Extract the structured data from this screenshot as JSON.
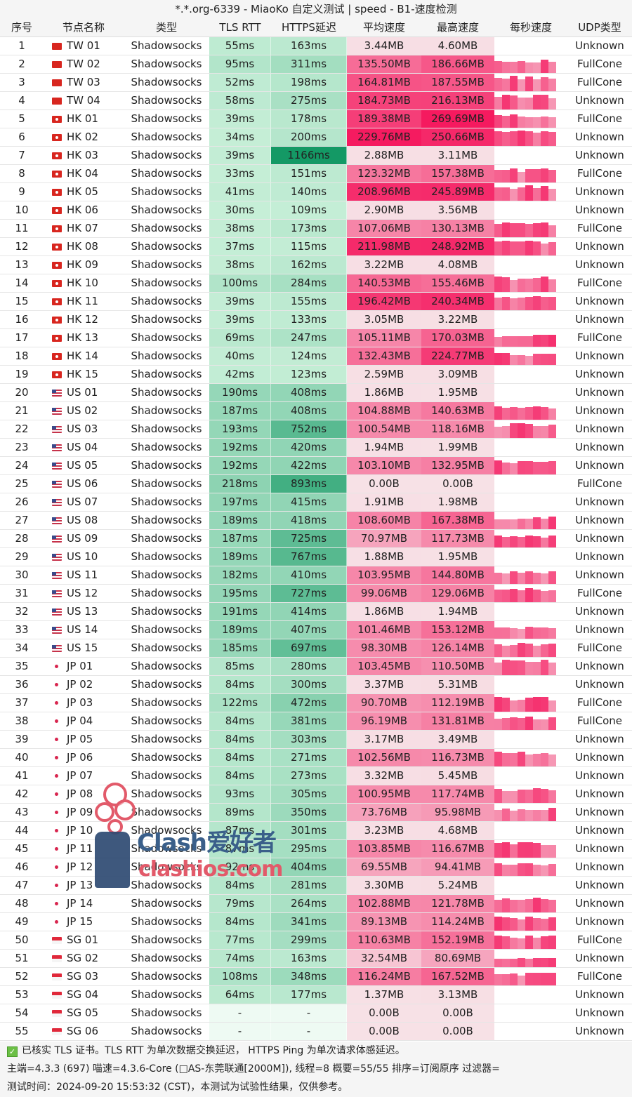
{
  "window": {
    "title": "*.*.org-6339 - MiaoKo 自定义测试 | speed - B1-速度检测"
  },
  "table": {
    "headers": [
      "序号",
      "节点名称",
      "类型",
      "TLS RTT",
      "HTTPS延迟",
      "平均速度",
      "最高速度",
      "每秒速度",
      "UDP类型"
    ],
    "rows": [
      {
        "idx": "1",
        "flag": "tw",
        "name": "TW 01",
        "type": "Shadowsocks",
        "tls": "55ms",
        "https": "163ms",
        "avg": "3.44MB",
        "max": "4.60MB",
        "udp": "Unknown"
      },
      {
        "idx": "2",
        "flag": "tw",
        "name": "TW 02",
        "type": "Shadowsocks",
        "tls": "95ms",
        "https": "311ms",
        "avg": "135.50MB",
        "max": "186.66MB",
        "udp": "FullCone"
      },
      {
        "idx": "3",
        "flag": "tw",
        "name": "TW 03",
        "type": "Shadowsocks",
        "tls": "52ms",
        "https": "198ms",
        "avg": "164.81MB",
        "max": "187.55MB",
        "udp": "FullCone"
      },
      {
        "idx": "4",
        "flag": "tw",
        "name": "TW 04",
        "type": "Shadowsocks",
        "tls": "58ms",
        "https": "275ms",
        "avg": "184.73MB",
        "max": "216.13MB",
        "udp": "Unknown"
      },
      {
        "idx": "5",
        "flag": "hk",
        "name": "HK 01",
        "type": "Shadowsocks",
        "tls": "39ms",
        "https": "178ms",
        "avg": "189.38MB",
        "max": "269.69MB",
        "udp": "FullCone"
      },
      {
        "idx": "6",
        "flag": "hk",
        "name": "HK 02",
        "type": "Shadowsocks",
        "tls": "34ms",
        "https": "200ms",
        "avg": "229.76MB",
        "max": "250.66MB",
        "udp": "Unknown"
      },
      {
        "idx": "7",
        "flag": "hk",
        "name": "HK 03",
        "type": "Shadowsocks",
        "tls": "39ms",
        "https": "1166ms",
        "avg": "2.88MB",
        "max": "3.11MB",
        "udp": "Unknown"
      },
      {
        "idx": "8",
        "flag": "hk",
        "name": "HK 04",
        "type": "Shadowsocks",
        "tls": "33ms",
        "https": "151ms",
        "avg": "123.32MB",
        "max": "157.38MB",
        "udp": "FullCone"
      },
      {
        "idx": "9",
        "flag": "hk",
        "name": "HK 05",
        "type": "Shadowsocks",
        "tls": "41ms",
        "https": "140ms",
        "avg": "208.96MB",
        "max": "245.89MB",
        "udp": "Unknown"
      },
      {
        "idx": "10",
        "flag": "hk",
        "name": "HK 06",
        "type": "Shadowsocks",
        "tls": "30ms",
        "https": "109ms",
        "avg": "2.90MB",
        "max": "3.56MB",
        "udp": "Unknown"
      },
      {
        "idx": "11",
        "flag": "hk",
        "name": "HK 07",
        "type": "Shadowsocks",
        "tls": "38ms",
        "https": "173ms",
        "avg": "107.06MB",
        "max": "130.13MB",
        "udp": "FullCone"
      },
      {
        "idx": "12",
        "flag": "hk",
        "name": "HK 08",
        "type": "Shadowsocks",
        "tls": "37ms",
        "https": "115ms",
        "avg": "211.98MB",
        "max": "248.92MB",
        "udp": "Unknown"
      },
      {
        "idx": "13",
        "flag": "hk",
        "name": "HK 09",
        "type": "Shadowsocks",
        "tls": "38ms",
        "https": "162ms",
        "avg": "3.22MB",
        "max": "4.08MB",
        "udp": "Unknown"
      },
      {
        "idx": "14",
        "flag": "hk",
        "name": "HK 10",
        "type": "Shadowsocks",
        "tls": "100ms",
        "https": "284ms",
        "avg": "140.53MB",
        "max": "155.46MB",
        "udp": "FullCone"
      },
      {
        "idx": "15",
        "flag": "hk",
        "name": "HK 11",
        "type": "Shadowsocks",
        "tls": "39ms",
        "https": "155ms",
        "avg": "196.42MB",
        "max": "240.34MB",
        "udp": "Unknown"
      },
      {
        "idx": "16",
        "flag": "hk",
        "name": "HK 12",
        "type": "Shadowsocks",
        "tls": "39ms",
        "https": "133ms",
        "avg": "3.05MB",
        "max": "3.22MB",
        "udp": "Unknown"
      },
      {
        "idx": "17",
        "flag": "hk",
        "name": "HK 13",
        "type": "Shadowsocks",
        "tls": "69ms",
        "https": "247ms",
        "avg": "105.11MB",
        "max": "170.03MB",
        "udp": "FullCone"
      },
      {
        "idx": "18",
        "flag": "hk",
        "name": "HK 14",
        "type": "Shadowsocks",
        "tls": "40ms",
        "https": "124ms",
        "avg": "132.43MB",
        "max": "224.77MB",
        "udp": "Unknown"
      },
      {
        "idx": "19",
        "flag": "hk",
        "name": "HK 15",
        "type": "Shadowsocks",
        "tls": "42ms",
        "https": "123ms",
        "avg": "2.59MB",
        "max": "3.09MB",
        "udp": "Unknown"
      },
      {
        "idx": "20",
        "flag": "us",
        "name": "US 01",
        "type": "Shadowsocks",
        "tls": "190ms",
        "https": "408ms",
        "avg": "1.86MB",
        "max": "1.95MB",
        "udp": "Unknown"
      },
      {
        "idx": "21",
        "flag": "us",
        "name": "US 02",
        "type": "Shadowsocks",
        "tls": "187ms",
        "https": "408ms",
        "avg": "104.88MB",
        "max": "140.63MB",
        "udp": "Unknown"
      },
      {
        "idx": "22",
        "flag": "us",
        "name": "US 03",
        "type": "Shadowsocks",
        "tls": "193ms",
        "https": "752ms",
        "avg": "100.54MB",
        "max": "118.16MB",
        "udp": "Unknown"
      },
      {
        "idx": "23",
        "flag": "us",
        "name": "US 04",
        "type": "Shadowsocks",
        "tls": "192ms",
        "https": "420ms",
        "avg": "1.94MB",
        "max": "1.99MB",
        "udp": "Unknown"
      },
      {
        "idx": "24",
        "flag": "us",
        "name": "US 05",
        "type": "Shadowsocks",
        "tls": "192ms",
        "https": "422ms",
        "avg": "103.10MB",
        "max": "132.95MB",
        "udp": "Unknown"
      },
      {
        "idx": "25",
        "flag": "us",
        "name": "US 06",
        "type": "Shadowsocks",
        "tls": "218ms",
        "https": "893ms",
        "avg": "0.00B",
        "max": "0.00B",
        "udp": "FullCone"
      },
      {
        "idx": "26",
        "flag": "us",
        "name": "US 07",
        "type": "Shadowsocks",
        "tls": "197ms",
        "https": "415ms",
        "avg": "1.91MB",
        "max": "1.98MB",
        "udp": "Unknown"
      },
      {
        "idx": "27",
        "flag": "us",
        "name": "US 08",
        "type": "Shadowsocks",
        "tls": "189ms",
        "https": "418ms",
        "avg": "108.60MB",
        "max": "167.38MB",
        "udp": "Unknown"
      },
      {
        "idx": "28",
        "flag": "us",
        "name": "US 09",
        "type": "Shadowsocks",
        "tls": "187ms",
        "https": "725ms",
        "avg": "70.97MB",
        "max": "117.73MB",
        "udp": "Unknown"
      },
      {
        "idx": "29",
        "flag": "us",
        "name": "US 10",
        "type": "Shadowsocks",
        "tls": "189ms",
        "https": "767ms",
        "avg": "1.88MB",
        "max": "1.95MB",
        "udp": "Unknown"
      },
      {
        "idx": "30",
        "flag": "us",
        "name": "US 11",
        "type": "Shadowsocks",
        "tls": "182ms",
        "https": "410ms",
        "avg": "103.95MB",
        "max": "144.80MB",
        "udp": "Unknown"
      },
      {
        "idx": "31",
        "flag": "us",
        "name": "US 12",
        "type": "Shadowsocks",
        "tls": "195ms",
        "https": "727ms",
        "avg": "99.06MB",
        "max": "129.06MB",
        "udp": "FullCone"
      },
      {
        "idx": "32",
        "flag": "us",
        "name": "US 13",
        "type": "Shadowsocks",
        "tls": "191ms",
        "https": "414ms",
        "avg": "1.86MB",
        "max": "1.94MB",
        "udp": "Unknown"
      },
      {
        "idx": "33",
        "flag": "us",
        "name": "US 14",
        "type": "Shadowsocks",
        "tls": "189ms",
        "https": "407ms",
        "avg": "101.46MB",
        "max": "153.12MB",
        "udp": "Unknown"
      },
      {
        "idx": "34",
        "flag": "us",
        "name": "US 15",
        "type": "Shadowsocks",
        "tls": "185ms",
        "https": "697ms",
        "avg": "98.30MB",
        "max": "126.14MB",
        "udp": "FullCone"
      },
      {
        "idx": "35",
        "flag": "jp",
        "name": "JP 01",
        "type": "Shadowsocks",
        "tls": "85ms",
        "https": "280ms",
        "avg": "103.45MB",
        "max": "110.50MB",
        "udp": "Unknown"
      },
      {
        "idx": "36",
        "flag": "jp",
        "name": "JP 02",
        "type": "Shadowsocks",
        "tls": "84ms",
        "https": "300ms",
        "avg": "3.37MB",
        "max": "5.31MB",
        "udp": "Unknown"
      },
      {
        "idx": "37",
        "flag": "jp",
        "name": "JP 03",
        "type": "Shadowsocks",
        "tls": "122ms",
        "https": "472ms",
        "avg": "90.70MB",
        "max": "112.19MB",
        "udp": "FullCone"
      },
      {
        "idx": "38",
        "flag": "jp",
        "name": "JP 04",
        "type": "Shadowsocks",
        "tls": "84ms",
        "https": "381ms",
        "avg": "96.19MB",
        "max": "131.81MB",
        "udp": "FullCone"
      },
      {
        "idx": "39",
        "flag": "jp",
        "name": "JP 05",
        "type": "Shadowsocks",
        "tls": "84ms",
        "https": "303ms",
        "avg": "3.17MB",
        "max": "3.49MB",
        "udp": "Unknown"
      },
      {
        "idx": "40",
        "flag": "jp",
        "name": "JP 06",
        "type": "Shadowsocks",
        "tls": "84ms",
        "https": "271ms",
        "avg": "102.56MB",
        "max": "116.73MB",
        "udp": "Unknown"
      },
      {
        "idx": "41",
        "flag": "jp",
        "name": "JP 07",
        "type": "Shadowsocks",
        "tls": "84ms",
        "https": "273ms",
        "avg": "3.32MB",
        "max": "5.45MB",
        "udp": "Unknown"
      },
      {
        "idx": "42",
        "flag": "jp",
        "name": "JP 08",
        "type": "Shadowsocks",
        "tls": "93ms",
        "https": "305ms",
        "avg": "100.95MB",
        "max": "117.74MB",
        "udp": "Unknown"
      },
      {
        "idx": "43",
        "flag": "jp",
        "name": "JP 09",
        "type": "Shadowsocks",
        "tls": "89ms",
        "https": "350ms",
        "avg": "73.76MB",
        "max": "95.98MB",
        "udp": "Unknown"
      },
      {
        "idx": "44",
        "flag": "jp",
        "name": "JP 10",
        "type": "Shadowsocks",
        "tls": "87ms",
        "https": "301ms",
        "avg": "3.23MB",
        "max": "4.68MB",
        "udp": "Unknown"
      },
      {
        "idx": "45",
        "flag": "jp",
        "name": "JP 11",
        "type": "Shadowsocks",
        "tls": "87ms",
        "https": "295ms",
        "avg": "103.85MB",
        "max": "116.67MB",
        "udp": "Unknown"
      },
      {
        "idx": "46",
        "flag": "jp",
        "name": "JP 12",
        "type": "Shadowsocks",
        "tls": "92ms",
        "https": "404ms",
        "avg": "69.55MB",
        "max": "94.41MB",
        "udp": "Unknown"
      },
      {
        "idx": "47",
        "flag": "jp",
        "name": "JP 13",
        "type": "Shadowsocks",
        "tls": "84ms",
        "https": "281ms",
        "avg": "3.30MB",
        "max": "5.24MB",
        "udp": "Unknown"
      },
      {
        "idx": "48",
        "flag": "jp",
        "name": "JP 14",
        "type": "Shadowsocks",
        "tls": "79ms",
        "https": "264ms",
        "avg": "102.88MB",
        "max": "121.78MB",
        "udp": "Unknown"
      },
      {
        "idx": "49",
        "flag": "jp",
        "name": "JP 15",
        "type": "Shadowsocks",
        "tls": "84ms",
        "https": "341ms",
        "avg": "89.13MB",
        "max": "114.24MB",
        "udp": "Unknown"
      },
      {
        "idx": "50",
        "flag": "sg",
        "name": "SG 01",
        "type": "Shadowsocks",
        "tls": "77ms",
        "https": "299ms",
        "avg": "110.63MB",
        "max": "152.19MB",
        "udp": "FullCone"
      },
      {
        "idx": "51",
        "flag": "sg",
        "name": "SG 02",
        "type": "Shadowsocks",
        "tls": "74ms",
        "https": "163ms",
        "avg": "32.54MB",
        "max": "80.69MB",
        "udp": "Unknown"
      },
      {
        "idx": "52",
        "flag": "sg",
        "name": "SG 03",
        "type": "Shadowsocks",
        "tls": "108ms",
        "https": "348ms",
        "avg": "116.24MB",
        "max": "167.52MB",
        "udp": "FullCone"
      },
      {
        "idx": "53",
        "flag": "sg",
        "name": "SG 04",
        "type": "Shadowsocks",
        "tls": "64ms",
        "https": "177ms",
        "avg": "1.37MB",
        "max": "3.13MB",
        "udp": "Unknown"
      },
      {
        "idx": "54",
        "flag": "sg",
        "name": "SG 05",
        "type": "Shadowsocks",
        "tls": "-",
        "https": "-",
        "avg": "0.00B",
        "max": "0.00B",
        "udp": "Unknown"
      },
      {
        "idx": "55",
        "flag": "sg",
        "name": "SG 06",
        "type": "Shadowsocks",
        "tls": "-",
        "https": "-",
        "avg": "0.00B",
        "max": "0.00B",
        "udp": "Unknown"
      }
    ]
  },
  "footer": {
    "line1": "已核实 TLS 证书。TLS RTT 为单次数据交换延迟， HTTPS Ping 为单次请求体感延迟。",
    "line2": "主端=4.3.3 (697) 喵速=4.3.6-Core (□AS-东莞联通[2000M]), 线程=8 概要=55/55 排序=订阅原序 过滤器=",
    "line3": "测试时间：2024-09-20 15:53:32 (CST)，本测试为试验性结果，仅供参考。"
  },
  "watermark": {
    "line1": "Clash爱好者",
    "line2": "clashios.com"
  },
  "colors": {
    "green_light": "#c9f0d9",
    "green_dark": "#129863",
    "pink_light": "#f7e1e6",
    "pink_dark": "#f5125a"
  }
}
